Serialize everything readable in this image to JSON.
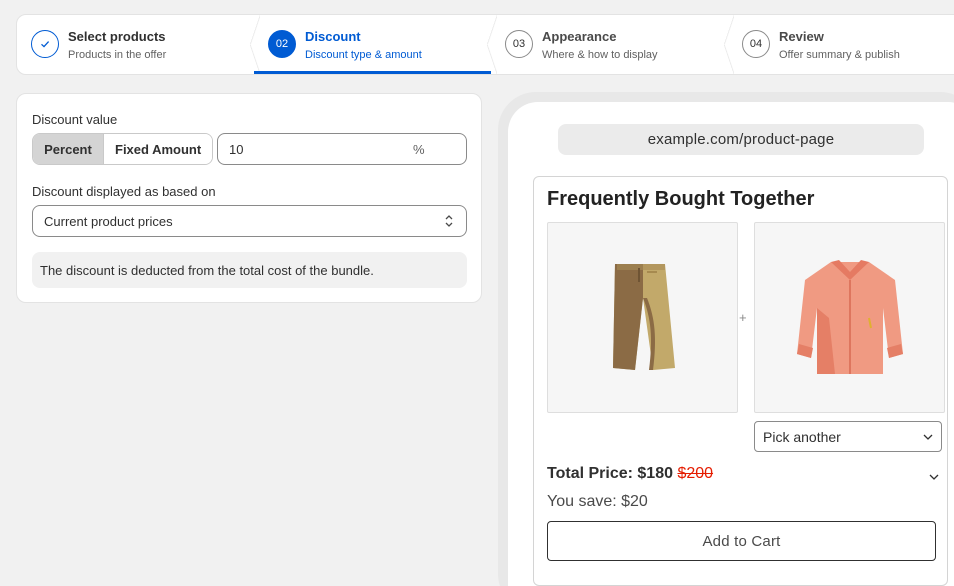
{
  "steps": [
    {
      "number": "",
      "title": "Select products",
      "subtitle": "Products in the offer",
      "state": "done"
    },
    {
      "number": "02",
      "title": "Discount",
      "subtitle": "Discount type & amount",
      "state": "active"
    },
    {
      "number": "03",
      "title": "Appearance",
      "subtitle": "Where & how to display",
      "state": "pending"
    },
    {
      "number": "04",
      "title": "Review",
      "subtitle": "Offer summary & publish",
      "state": "pending"
    }
  ],
  "discount": {
    "value_label": "Discount value",
    "type_options": [
      "Percent",
      "Fixed Amount"
    ],
    "selected_type": "Percent",
    "amount": "10",
    "unit": "%",
    "based_on_label": "Discount displayed as based on",
    "based_on_value": "Current product prices",
    "note": "The discount is deducted from the total cost of the bundle."
  },
  "preview": {
    "url": "example.com/product-page",
    "widget_title": "Frequently Bought Together",
    "products": [
      {
        "name": "shorts",
        "icon": "shorts-image"
      },
      {
        "name": "shirt",
        "icon": "shirt-image"
      }
    ],
    "plus": "+",
    "pick_label": "Pick another",
    "total_label": "Total Price:",
    "total_price": "$180",
    "original_price": "$200",
    "save_text": "You save: $20",
    "cart_label": "Add to Cart"
  },
  "colors": {
    "accent": "#005bd3",
    "strike": "#e51c00"
  }
}
